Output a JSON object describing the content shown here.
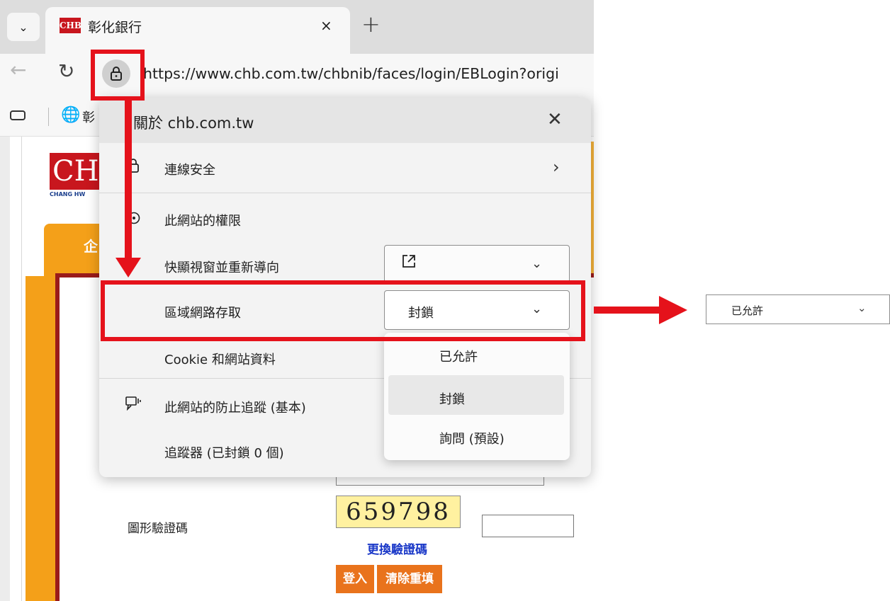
{
  "browser": {
    "tab_title": "彰化銀行",
    "favicon_text": "CHB",
    "close_glyph": "×",
    "new_tab_glyph": "+",
    "url": "https://www.chb.com.tw/chbnib/faces/login/EBLogin?origi",
    "favbar_item": "彰"
  },
  "page": {
    "logo_text": "CH",
    "logo_sub": "CHANG HW",
    "orange_tab_text": "企",
    "captcha_label": "圖形驗證碼",
    "captcha_value": "659798",
    "captcha_refresh": "更換驗證碼",
    "login_button": "登入",
    "reset_button": "清除重填"
  },
  "popup": {
    "title": "關於 chb.com.tw",
    "connection_security": "連線安全",
    "site_permissions": "此網站的權限",
    "popups_redirects": "快顯視窗並重新導向",
    "local_network_access": "區域網路存取",
    "lan_selected_value": "封鎖",
    "cookies_site_data": "Cookie 和網站資料",
    "tracking_prevention": "此網站的防止追蹤 (基本)",
    "trackers": "追蹤器 (已封鎖 0 個)",
    "options": [
      "已允許",
      "封鎖",
      "詢問 (預設)"
    ]
  },
  "result": {
    "value": "已允許"
  },
  "colors": {
    "annotation_red": "#e5121b",
    "brand_red": "#c8161e",
    "brand_orange": "#f4a019"
  }
}
